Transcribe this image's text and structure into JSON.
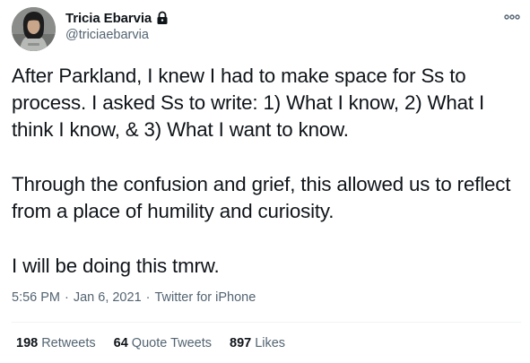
{
  "author": {
    "display_name": "Tricia Ebarvia",
    "handle": "@triciaebarvia",
    "protected_icon": "lock-icon"
  },
  "tweet": {
    "paragraphs": [
      "After Parkland, I knew I had to make space for Ss to process. I asked Ss to write: 1) What I know, 2) What I think I know, & 3) What I want to know.",
      "Through the confusion and grief, this allowed us to reflect from a place of humility and curiosity.",
      "I will be doing this tmrw."
    ],
    "time": "5:56 PM",
    "separator": "·",
    "date": "Jan 6, 2021",
    "source": "Twitter for iPhone"
  },
  "stats": {
    "retweets_count": "198",
    "retweets_label": "Retweets",
    "quotes_count": "64",
    "quotes_label": "Quote Tweets",
    "likes_count": "897",
    "likes_label": "Likes"
  },
  "icons": {
    "more": "more-options-icon",
    "avatar": "avatar"
  },
  "colors": {
    "text_primary": "#0f1419",
    "text_secondary": "#536471",
    "divider": "#eff3f4"
  }
}
